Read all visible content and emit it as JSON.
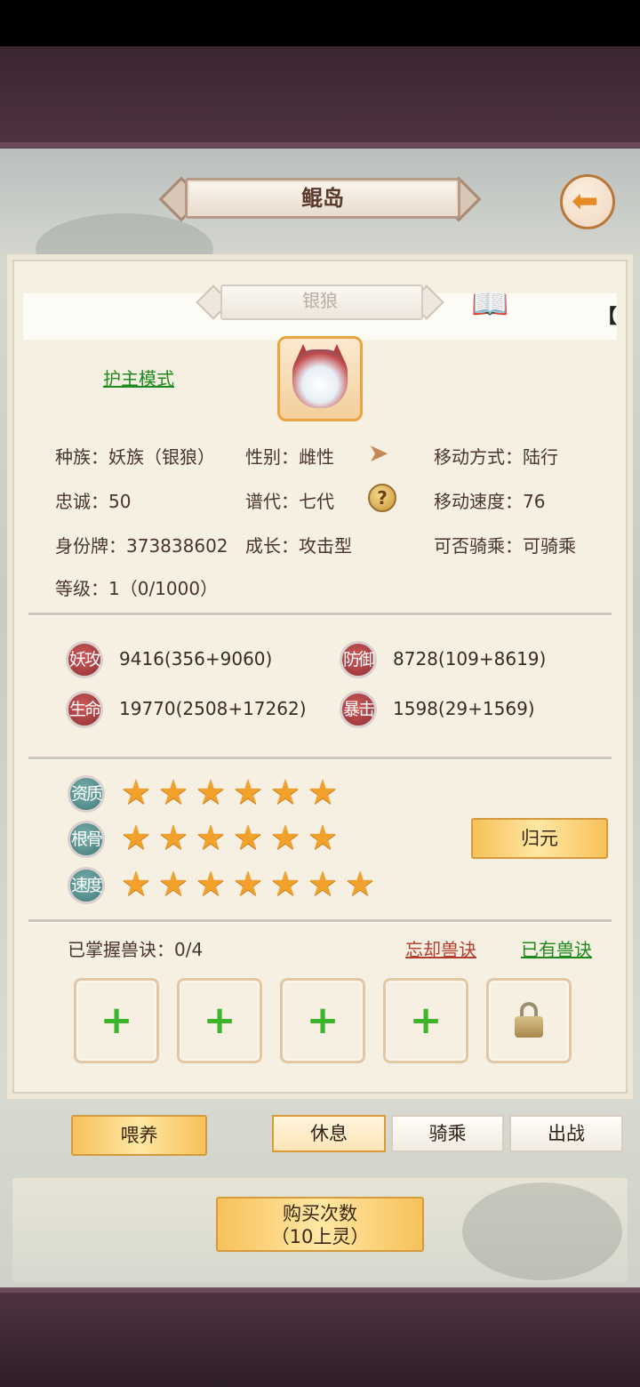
{
  "header": {
    "title": "鲲岛",
    "back_icon": "back-arrow-icon"
  },
  "pet": {
    "name": "银狼",
    "mode_link": "护主模式",
    "info": {
      "race": "种族：妖族（银狼）",
      "gender": "性别：雌性",
      "move_type": "移动方式：陆行",
      "loyalty": "忠诚：50",
      "generation": "谱代：七代",
      "move_speed": "移动速度：76",
      "id_tag": "身份牌：373838602",
      "growth": "成长：攻击型",
      "rideable": "可否骑乘：可骑乘",
      "level": "等级：1（0/1000）"
    },
    "stats": [
      {
        "label": "妖攻",
        "value": "9416(356+9060)"
      },
      {
        "label": "防御",
        "value": "8728(109+8619)"
      },
      {
        "label": "生命",
        "value": "19770(2508+17262)"
      },
      {
        "label": "暴击",
        "value": "1598(29+1569)"
      }
    ],
    "ratings": [
      {
        "label": "资质",
        "stars": 6
      },
      {
        "label": "根骨",
        "stars": 6
      },
      {
        "label": "速度",
        "stars": 7
      }
    ],
    "reset_button": "归元"
  },
  "skills": {
    "title": "已掌握兽诀：0/4",
    "forget_link": "忘却兽诀",
    "owned_link": "已有兽诀",
    "slots": [
      "+",
      "+",
      "+",
      "+",
      "locked"
    ]
  },
  "actions": {
    "feed": "喂养",
    "tabs": [
      {
        "label": "休息",
        "active": true
      },
      {
        "label": "骑乘",
        "active": false
      },
      {
        "label": "出战",
        "active": false
      }
    ]
  },
  "purchase": {
    "line1": "购买次数",
    "line2": "（10上灵）"
  },
  "colors": {
    "accent_gold": "#f7c15a",
    "link_green": "#1e8a1e",
    "link_red": "#b63b30"
  }
}
